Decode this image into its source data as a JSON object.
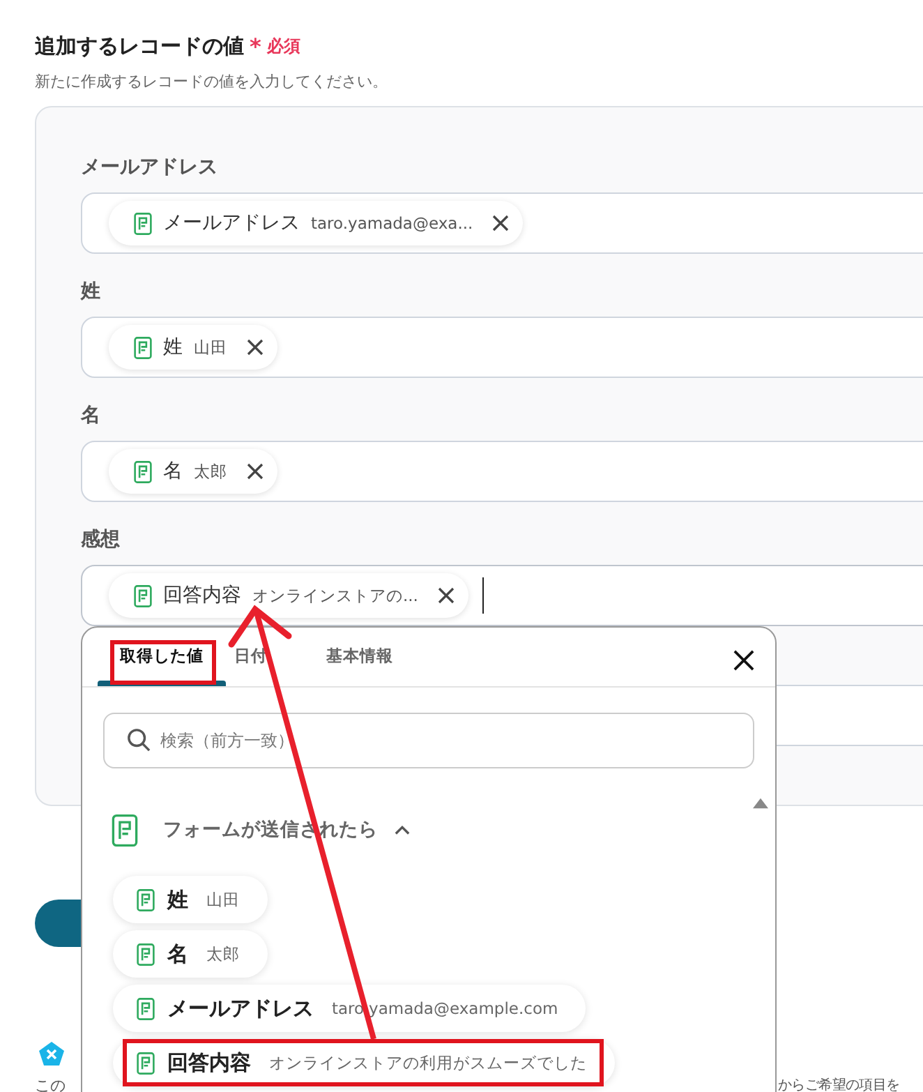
{
  "section": {
    "title": "追加するレコードの値",
    "required_mark": "*",
    "required_label": "必須",
    "description": "新たに作成するレコードの値を入力してください。"
  },
  "fields": [
    {
      "label": "メールアドレス",
      "focused": false,
      "chips": [
        {
          "name": "メールアドレス",
          "value": "taro.yamada@exa..."
        }
      ]
    },
    {
      "label": "姓",
      "focused": false,
      "chips": [
        {
          "name": "姓",
          "value": "山田"
        }
      ]
    },
    {
      "label": "名",
      "focused": false,
      "chips": [
        {
          "name": "名",
          "value": "太郎"
        }
      ]
    },
    {
      "label": "感想",
      "focused": true,
      "chips": [
        {
          "name": "回答内容",
          "value": "オンラインストアの..."
        }
      ]
    }
  ],
  "popup": {
    "tabs": [
      {
        "label": "取得した値",
        "selected": true
      },
      {
        "label": "日付",
        "selected": false
      },
      {
        "label": "基本情報",
        "selected": false
      }
    ],
    "search": {
      "placeholder": "検索（前方一致）"
    },
    "group": {
      "title": "フォームが送信されたら",
      "expanded": true,
      "items": [
        {
          "name": "姓",
          "value": "山田"
        },
        {
          "name": "名",
          "value": "太郎"
        },
        {
          "name": "メールアドレス",
          "value": "taro.yamada@example.com"
        },
        {
          "name": "回答内容",
          "value": "オンラインストアの利用がスムーズでした"
        }
      ]
    }
  },
  "footer": {
    "note_text": "この",
    "right_text": "からご希望の項目を"
  }
}
